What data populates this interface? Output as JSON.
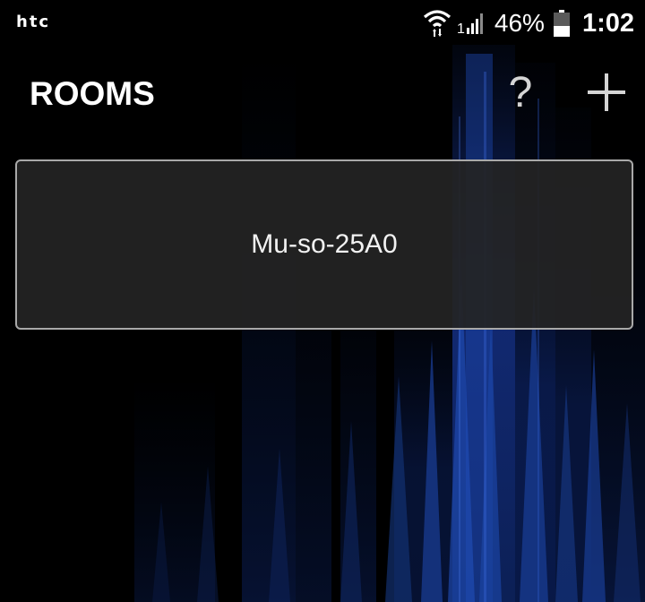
{
  "status_bar": {
    "carrier": "htc",
    "signal_label": "1",
    "battery_percent": "46%",
    "battery_level": 0.46,
    "time": "1:02"
  },
  "header": {
    "title": "ROOMS",
    "help_label": "?",
    "add_icon": "plus-icon"
  },
  "rooms": [
    {
      "name": "Mu-so-25A0"
    }
  ],
  "colors": {
    "background": "#000000",
    "accent_blue": "#1c3f9e",
    "card_background": "#242424",
    "card_border": "#a9a9a9",
    "icon_gray": "#d5d5d5"
  }
}
